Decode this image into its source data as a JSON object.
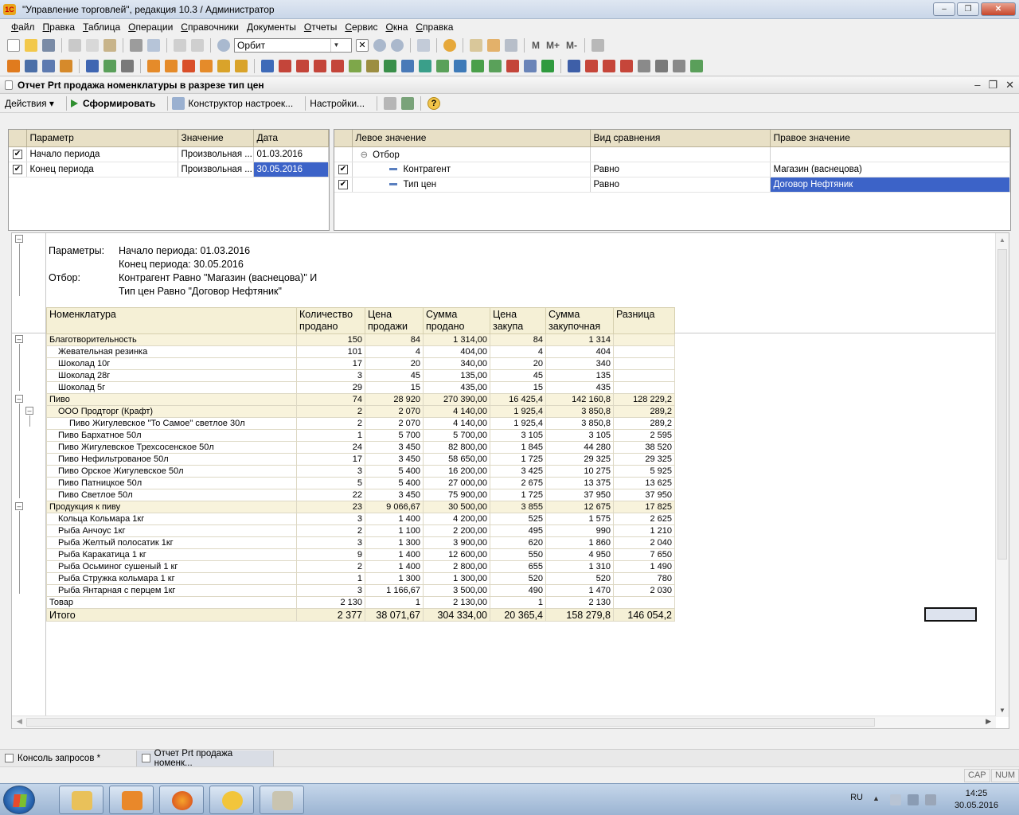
{
  "window": {
    "title": "\"Управление торговлей\", редакция 10.3 / Администратор"
  },
  "menu": [
    "Файл",
    "Правка",
    "Таблица",
    "Операции",
    "Справочники",
    "Документы",
    "Отчеты",
    "Сервис",
    "Окна",
    "Справка"
  ],
  "toolbar": {
    "search_value": "Орбит",
    "m_buttons": [
      "M",
      "M+",
      "M-"
    ]
  },
  "document": {
    "title": "Отчет  Prt продажа номенклатуры в разрезе тип цен",
    "actions": {
      "actions_label": "Действия",
      "run_label": "Сформировать",
      "constructor_label": "Конструктор настроек...",
      "settings_label": "Настройки..."
    }
  },
  "params_grid": {
    "headers": [
      "Параметр",
      "Значение",
      "Дата"
    ],
    "rows": [
      {
        "name": "Начало периода",
        "value": "Произвольная ...",
        "date": "01.03.2016"
      },
      {
        "name": "Конец периода",
        "value": "Произвольная ...",
        "date": "30.05.2016"
      }
    ]
  },
  "filter_grid": {
    "headers": [
      "Левое значение",
      "Вид сравнения",
      "Правое значение"
    ],
    "group": "Отбор",
    "rows": [
      {
        "left": "Контрагент",
        "cmp": "Равно",
        "right": "Магазин (васнецова)"
      },
      {
        "left": "Тип цен",
        "cmp": "Равно",
        "right": "Договор Нефтяник"
      }
    ]
  },
  "report": {
    "params_label": "Параметры:",
    "param_line1": "Начало периода: 01.03.2016",
    "param_line2": "Конец периода: 30.05.2016",
    "filter_label": "Отбор:",
    "filter_line1": "Контрагент Равно \"Магазин (васнецова)\" И",
    "filter_line2": "Тип цен Равно \"Договор Нефтяник\"",
    "headers": [
      [
        "Номенклатура",
        ""
      ],
      [
        "Количество",
        "продано"
      ],
      [
        "Цена",
        "продажи"
      ],
      [
        "Сумма",
        "продано"
      ],
      [
        "Цена",
        "закупа"
      ],
      [
        "Сумма",
        "закупочная"
      ],
      [
        "Разница",
        ""
      ]
    ],
    "rows": [
      {
        "lvl": 0,
        "g": true,
        "c": [
          "Благотворительность",
          "150",
          "84",
          "1 314,00",
          "84",
          "1 314",
          ""
        ]
      },
      {
        "lvl": 1,
        "c": [
          "Жевательная резинка",
          "101",
          "4",
          "404,00",
          "4",
          "404",
          ""
        ]
      },
      {
        "lvl": 1,
        "c": [
          "Шоколад 10г",
          "17",
          "20",
          "340,00",
          "20",
          "340",
          ""
        ]
      },
      {
        "lvl": 1,
        "c": [
          "Шоколад 28г",
          "3",
          "45",
          "135,00",
          "45",
          "135",
          ""
        ]
      },
      {
        "lvl": 1,
        "c": [
          "Шоколад 5г",
          "29",
          "15",
          "435,00",
          "15",
          "435",
          ""
        ]
      },
      {
        "lvl": 0,
        "g": true,
        "c": [
          "Пиво",
          "74",
          "28 920",
          "270 390,00",
          "16 425,4",
          "142 160,8",
          "128 229,2"
        ]
      },
      {
        "lvl": 1,
        "g": true,
        "c": [
          "ООО Продторг (Крафт)",
          "2",
          "2 070",
          "4 140,00",
          "1 925,4",
          "3 850,8",
          "289,2"
        ]
      },
      {
        "lvl": 2,
        "c": [
          "Пиво Жигулевское \"То Самое\" светлое 30л",
          "2",
          "2 070",
          "4 140,00",
          "1 925,4",
          "3 850,8",
          "289,2"
        ]
      },
      {
        "lvl": 1,
        "c": [
          "Пиво Бархатное 50л",
          "1",
          "5 700",
          "5 700,00",
          "3 105",
          "3 105",
          "2 595"
        ]
      },
      {
        "lvl": 1,
        "c": [
          "Пиво Жигулевское Трехсосенское 50л",
          "24",
          "3 450",
          "82 800,00",
          "1 845",
          "44 280",
          "38 520"
        ]
      },
      {
        "lvl": 1,
        "c": [
          "Пиво Нефильтрованое 50л",
          "17",
          "3 450",
          "58 650,00",
          "1 725",
          "29 325",
          "29 325"
        ]
      },
      {
        "lvl": 1,
        "c": [
          "Пиво Орское Жигулевское 50л",
          "3",
          "5 400",
          "16 200,00",
          "3 425",
          "10 275",
          "5 925"
        ]
      },
      {
        "lvl": 1,
        "c": [
          "Пиво Патницкое 50л",
          "5",
          "5 400",
          "27 000,00",
          "2 675",
          "13 375",
          "13 625"
        ]
      },
      {
        "lvl": 1,
        "c": [
          "Пиво Светлое 50л",
          "22",
          "3 450",
          "75 900,00",
          "1 725",
          "37 950",
          "37 950"
        ]
      },
      {
        "lvl": 0,
        "g": true,
        "c": [
          "Продукция к пиву",
          "23",
          "9 066,67",
          "30 500,00",
          "3 855",
          "12 675",
          "17 825"
        ]
      },
      {
        "lvl": 1,
        "c": [
          "Кольца Кольмара 1кг",
          "3",
          "1 400",
          "4 200,00",
          "525",
          "1 575",
          "2 625"
        ]
      },
      {
        "lvl": 1,
        "c": [
          "Рыба Анчоус 1кг",
          "2",
          "1 100",
          "2 200,00",
          "495",
          "990",
          "1 210"
        ]
      },
      {
        "lvl": 1,
        "c": [
          "Рыба Желтый полосатик 1кг",
          "3",
          "1 300",
          "3 900,00",
          "620",
          "1 860",
          "2 040"
        ]
      },
      {
        "lvl": 1,
        "c": [
          "Рыба Каракатица 1 кг",
          "9",
          "1 400",
          "12 600,00",
          "550",
          "4 950",
          "7 650"
        ]
      },
      {
        "lvl": 1,
        "c": [
          "Рыба Осьминог сушеный 1 кг",
          "2",
          "1 400",
          "2 800,00",
          "655",
          "1 310",
          "1 490"
        ]
      },
      {
        "lvl": 1,
        "c": [
          "Рыба Стружка кольмара 1 кг",
          "1",
          "1 300",
          "1 300,00",
          "520",
          "520",
          "780"
        ]
      },
      {
        "lvl": 1,
        "c": [
          "Рыба Янтарная с перцем 1кг",
          "3",
          "1 166,67",
          "3 500,00",
          "490",
          "1 470",
          "2 030"
        ]
      },
      {
        "lvl": 0,
        "c": [
          "Товар",
          "2 130",
          "1",
          "2 130,00",
          "1",
          "2 130",
          ""
        ]
      }
    ],
    "total": [
      "Итого",
      "2 377",
      "38 071,67",
      "304 334,00",
      "20 365,4",
      "158 279,8",
      "146 054,2"
    ]
  },
  "window_tabs": [
    "Консоль запросов *",
    "Отчет  Prt продажа номенк..."
  ],
  "status": {
    "cap": "CAP",
    "num": "NUM"
  },
  "taskbar": {
    "lang": "RU",
    "time": "14:25",
    "date": "30.05.2016"
  }
}
